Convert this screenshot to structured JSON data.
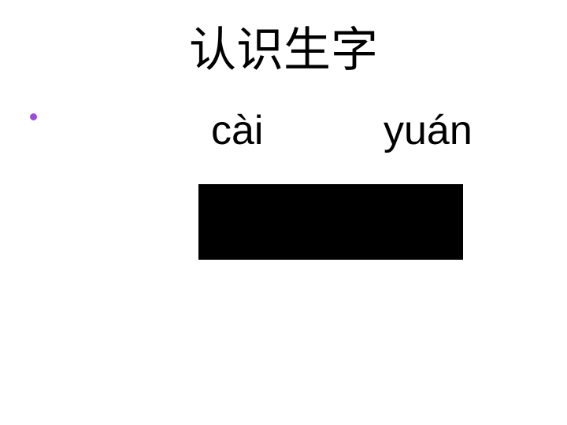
{
  "slide": {
    "title": "认识生字",
    "pinyin": [
      "cài",
      "yuán"
    ],
    "bullet_color": "#9b4fd8",
    "block_color": "#000000"
  }
}
